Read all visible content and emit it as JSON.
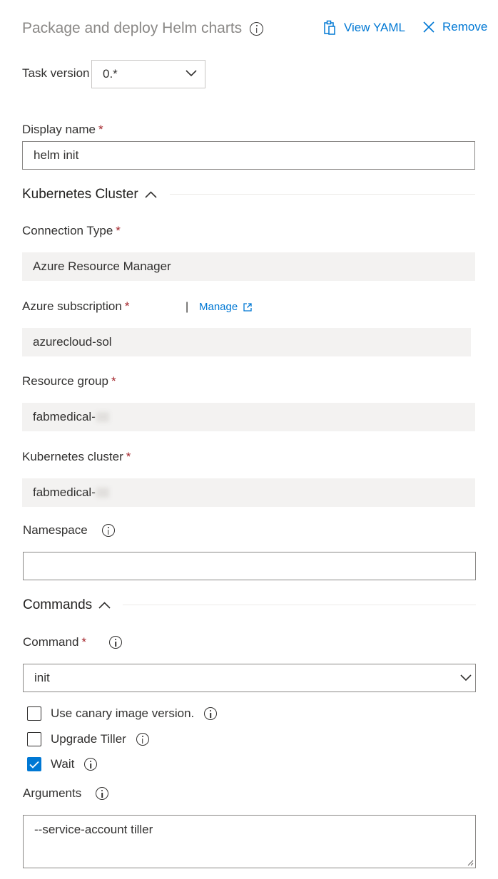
{
  "header": {
    "title": "Package and deploy Helm charts",
    "view_yaml": "View YAML",
    "remove": "Remove"
  },
  "task_version": {
    "label": "Task version",
    "value": "0.*"
  },
  "display_name": {
    "label": "Display name",
    "required": "*",
    "value": "helm init"
  },
  "kubernetes_cluster_section": {
    "title": "Kubernetes Cluster"
  },
  "connection_type": {
    "label": "Connection Type",
    "required": "*",
    "value": "Azure Resource Manager"
  },
  "azure_subscription": {
    "label": "Azure subscription",
    "required": "*",
    "separator": "|",
    "manage": "Manage",
    "value": "azurecloud-sol"
  },
  "resource_group": {
    "label": "Resource group",
    "required": "*",
    "value": "fabmedical-"
  },
  "kubernetes_cluster": {
    "label": "Kubernetes cluster",
    "required": "*",
    "value": "fabmedical-"
  },
  "namespace": {
    "label": "Namespace",
    "value": ""
  },
  "commands_section": {
    "title": "Commands"
  },
  "command": {
    "label": "Command",
    "required": "*",
    "value": "init"
  },
  "options": [
    {
      "label": "Use canary image version.",
      "checked": false
    },
    {
      "label": "Upgrade Tiller",
      "checked": false
    },
    {
      "label": "Wait",
      "checked": true
    }
  ],
  "arguments": {
    "label": "Arguments",
    "value": "--service-account tiller"
  },
  "colors": {
    "accent": "#0078d4",
    "required": "#a4262c",
    "readonly_bg": "#f3f2f1"
  }
}
